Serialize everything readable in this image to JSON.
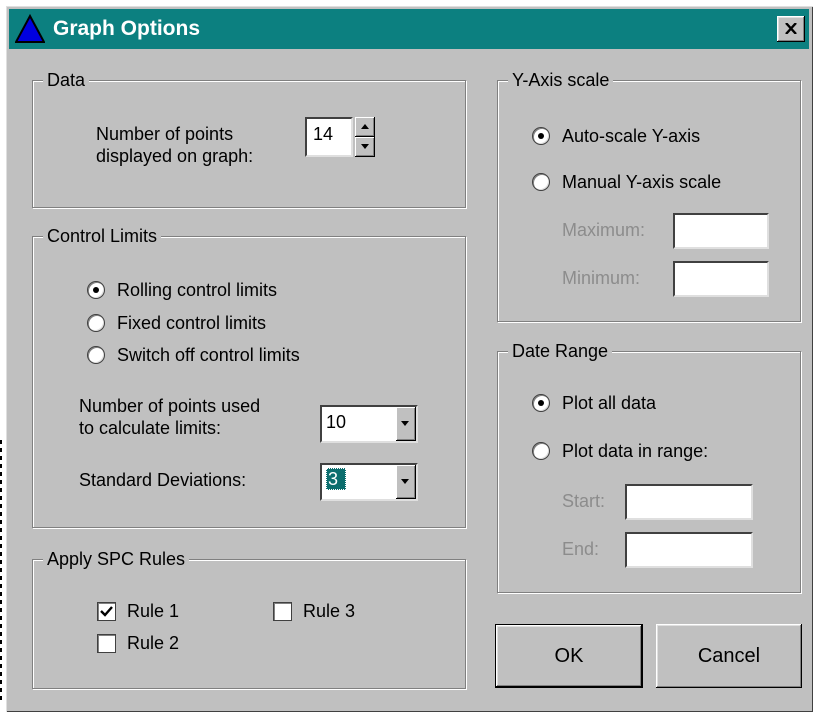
{
  "window": {
    "title": "Graph Options",
    "icon": "blue-triangle-icon"
  },
  "data_group": {
    "legend": "Data",
    "points_label_line1": "Number of points",
    "points_label_line2": "displayed on graph:",
    "points_value": "14"
  },
  "control_limits": {
    "legend": "Control Limits",
    "options": [
      {
        "label": "Rolling control limits",
        "selected": true
      },
      {
        "label": "Fixed control limits",
        "selected": false
      },
      {
        "label": "Switch off control limits",
        "selected": false
      }
    ],
    "points_used_line1": "Number of points used",
    "points_used_line2": "to calculate limits:",
    "points_used_value": "10",
    "std_dev_label": "Standard Deviations:",
    "std_dev_value": "3"
  },
  "spc_rules": {
    "legend": "Apply SPC Rules",
    "rules": [
      {
        "label": "Rule 1",
        "checked": true
      },
      {
        "label": "Rule 2",
        "checked": false
      },
      {
        "label": "Rule 3",
        "checked": false
      }
    ]
  },
  "y_axis": {
    "legend": "Y-Axis scale",
    "options": [
      {
        "label": "Auto-scale Y-axis",
        "selected": true
      },
      {
        "label": "Manual Y-axis scale",
        "selected": false
      }
    ],
    "maximum_label": "Maximum:",
    "minimum_label": "Minimum:",
    "maximum_value": "",
    "minimum_value": ""
  },
  "date_range": {
    "legend": "Date Range",
    "options": [
      {
        "label": "Plot all data",
        "selected": true
      },
      {
        "label": "Plot data in range:",
        "selected": false
      }
    ],
    "start_label": "Start:",
    "end_label": "End:",
    "start_value": "",
    "end_value": ""
  },
  "buttons": {
    "ok": "OK",
    "cancel": "Cancel"
  },
  "colors": {
    "titlebar": "#0c8080",
    "face": "#c0c0c0",
    "selection": "#0c6e6e"
  }
}
